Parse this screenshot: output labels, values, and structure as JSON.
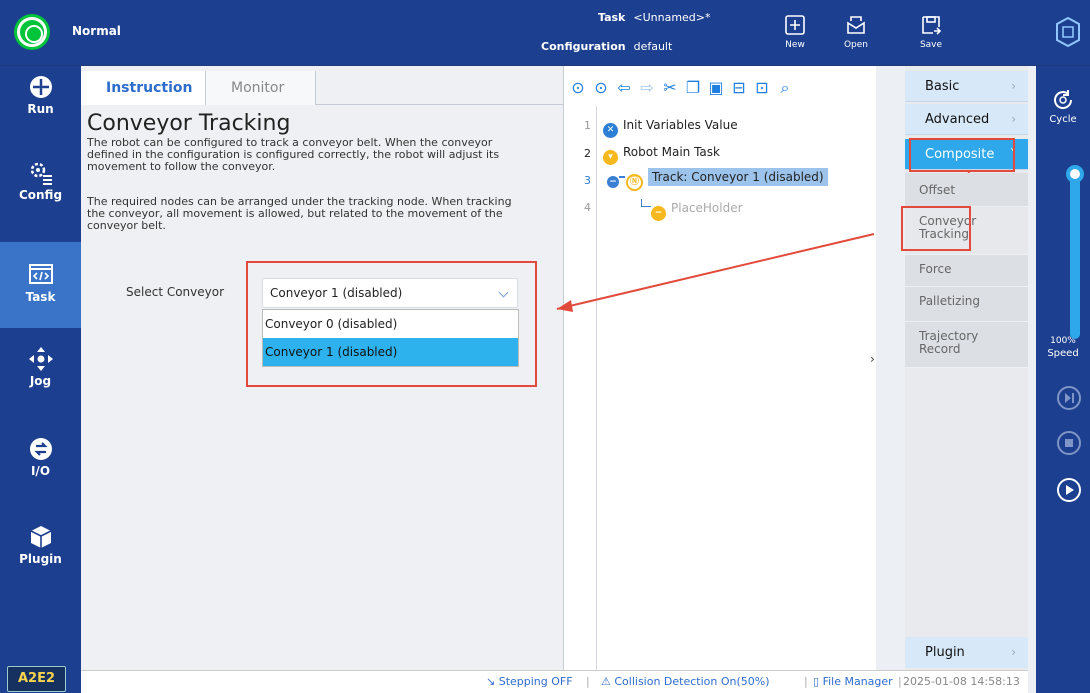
{
  "header": {
    "status": "Normal",
    "task_label": "Task",
    "task_value": "<Unnamed>*",
    "configuration_label": "Configuration",
    "configuration_value": "default",
    "buttons": {
      "new": "New",
      "open": "Open",
      "save": "Save"
    }
  },
  "sidebar": {
    "items": [
      {
        "label": "Run",
        "icon": "run-icon"
      },
      {
        "label": "Config",
        "icon": "config-icon"
      },
      {
        "label": "Task",
        "icon": "task-icon"
      },
      {
        "label": "Jog",
        "icon": "jog-icon"
      },
      {
        "label": "I/O",
        "icon": "io-icon"
      },
      {
        "label": "Plugin",
        "icon": "plugin-icon"
      }
    ],
    "active": "Task",
    "badge": "A2E2"
  },
  "instruction": {
    "tabs": [
      "Instruction",
      "Monitor"
    ],
    "active_tab": "Instruction",
    "title": "Conveyor Tracking",
    "desc1_l1": "The robot can be configured to track a conveyor belt. When the conveyor",
    "desc1_l2": "defined in the configuration is configured correctly, the robot will adjust its",
    "desc1_l3": "movement to follow the conveyor.",
    "desc2_l1": "The required nodes can be arranged under the tracking node. When tracking",
    "desc2_l2": "the conveyor, all movement is allowed, but related to the movement of the",
    "desc2_l3": "conveyor belt.",
    "select_label": "Select Conveyor",
    "select_value": "Conveyor 1 (disabled)",
    "options": [
      "Conveyor 0 (disabled)",
      "Conveyor 1 (disabled)"
    ],
    "selected_option": "Conveyor 1 (disabled)"
  },
  "program": {
    "toolbar_icons": [
      "move-up-icon",
      "move-down-icon",
      "undo-icon",
      "redo-icon",
      "cut-icon",
      "copy-icon",
      "paste-icon",
      "delete-icon",
      "suppress-icon",
      "search-icon"
    ],
    "lines": [
      {
        "num": "1",
        "text": "Init Variables Value"
      },
      {
        "num": "2",
        "text": "Robot Main Task"
      },
      {
        "num": "3",
        "text": "Track: Conveyor 1 (disabled)"
      },
      {
        "num": "4",
        "text": "PlaceHolder"
      }
    ]
  },
  "commands": {
    "categories": [
      "Basic",
      "Advanced",
      "Composite",
      "Plugin"
    ],
    "composite_items": [
      {
        "l1": "Offset",
        "l2": ""
      },
      {
        "l1": "Conveyor",
        "l2": "Tracking"
      },
      {
        "l1": "Force",
        "l2": ""
      },
      {
        "l1": "Palletizing",
        "l2": ""
      },
      {
        "l1": "Trajectory",
        "l2": "Record"
      }
    ]
  },
  "right_bar": {
    "cycle": "Cycle",
    "speed_value": "100%",
    "speed_label": "Speed"
  },
  "status_bar": {
    "stepping": "Stepping OFF",
    "collision": "Collision Detection On(50%)",
    "file_manager": "File Manager",
    "datetime": "2025-01-08 14:58:13"
  },
  "colors": {
    "accent": "#2ea8ea",
    "nav_bg": "#1d3f8f",
    "annotation": "#e24b3b",
    "status_ok": "#00c43a"
  }
}
